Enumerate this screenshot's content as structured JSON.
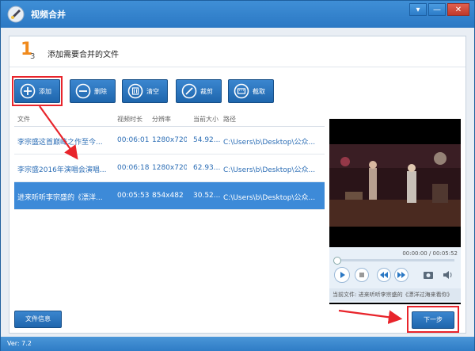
{
  "window": {
    "title": "视频合并",
    "minimize": "▾",
    "restore": "—",
    "close": "✕"
  },
  "step": {
    "number": "1",
    "total": "3",
    "title": "添加需要合并的文件"
  },
  "toolbar": {
    "add": "添加",
    "delete": "删除",
    "clear": "清空",
    "crop": "裁剪",
    "capture": "截取"
  },
  "table": {
    "headers": [
      "文件",
      "视频时长",
      "分辨率",
      "当前大小",
      "路径"
    ],
    "rows": [
      [
        "李宗盛这首巅峰之作至今...",
        "00:06:01",
        "1280x720",
        "54.92...",
        "C:\\Users\\b\\Desktop\\公众..."
      ],
      [
        "李宗盛2016年演唱会演唱...",
        "00:06:18",
        "1280x720",
        "62.93...",
        "C:\\Users\\b\\Desktop\\公众..."
      ],
      [
        "进来听听李宗盛的《漂洋...",
        "00:05:53",
        "854x482",
        "30.52...",
        "C:\\Users\\b\\Desktop\\公众..."
      ]
    ],
    "selected_row": 2
  },
  "player": {
    "time": "00:00:00 / 00:05:52",
    "now_playing_label": "当前文件:",
    "now_playing_title": "进来听听李宗盛的《漂洋过海来看你》"
  },
  "buttons": {
    "file_info": "文件信息",
    "next": "下一步"
  },
  "status": {
    "version": "Ver: 7.2"
  },
  "colors": {
    "accent": "#2b78c4",
    "highlight": "#e8242b",
    "step": "#f08a1c",
    "selected_row": "#3d8ad8"
  }
}
